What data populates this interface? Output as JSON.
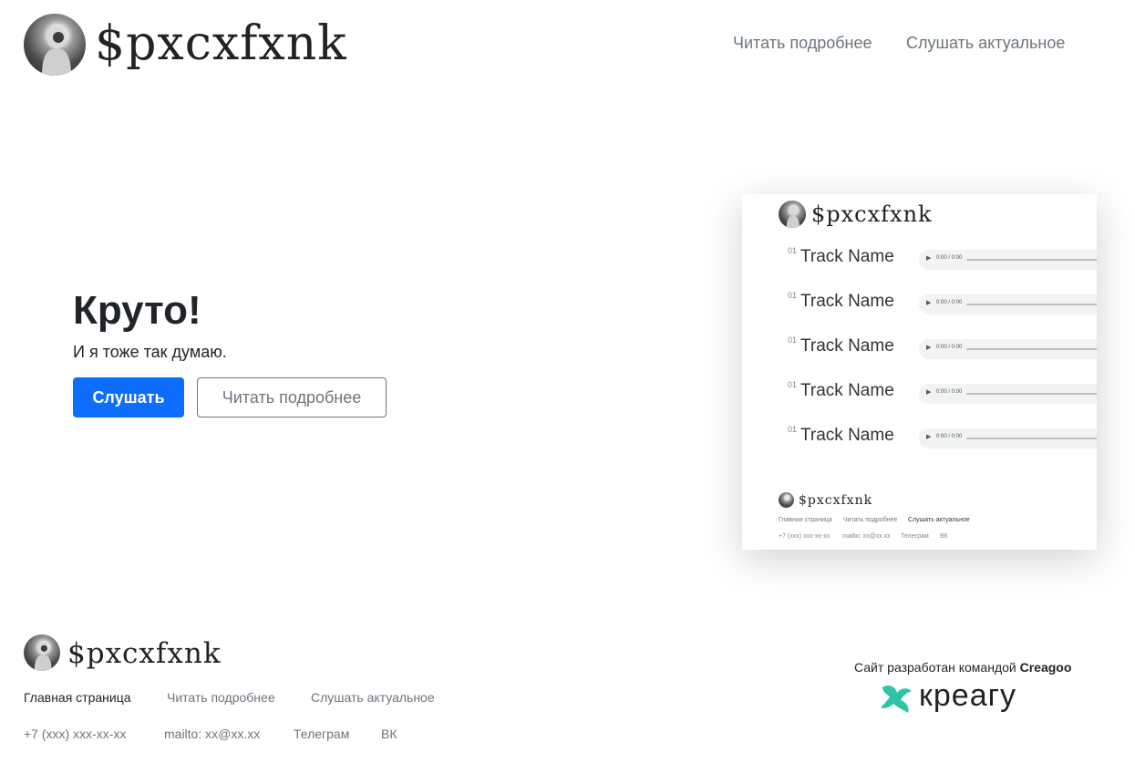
{
  "header": {
    "brand": "$pxcxfxnk",
    "nav": [
      "Читать подробнее",
      "Слушать актуальное"
    ]
  },
  "hero": {
    "title": "Круто!",
    "subtitle": "И я тоже так думаю.",
    "primary_button": "Слушать",
    "secondary_button": "Читать подробнее"
  },
  "preview": {
    "brand": "$pxcxfxnk",
    "tracks": [
      {
        "num": "01",
        "name": "Track Name",
        "time": "0:00 / 0:00"
      },
      {
        "num": "01",
        "name": "Track Name",
        "time": "0:00 / 0:00"
      },
      {
        "num": "01",
        "name": "Track Name",
        "time": "0:00 / 0:00"
      },
      {
        "num": "01",
        "name": "Track Name",
        "time": "0:00 / 0:00"
      },
      {
        "num": "01",
        "name": "Track Name",
        "time": "0:00 / 0:00"
      }
    ],
    "footer_brand": "$pxcxfxnk",
    "footer_links": [
      "Главная страница",
      "Читать подробнее",
      "Слушать актуальное"
    ],
    "footer_contacts": [
      "+7 (xxx) xxx-xx-xx",
      "mailto: xx@xx.xx",
      "Телеграм",
      "ВК"
    ]
  },
  "footer": {
    "brand": "$pxcxfxnk",
    "links": [
      "Главная страница",
      "Читать подробнее",
      "Слушать актуальное"
    ],
    "contacts": [
      "+7 (xxx) xxx-xx-xx",
      "mailto: xx@xx.xx",
      "Телеграм",
      "ВК"
    ],
    "credit_prefix": "Сайт разработан командой",
    "credit_team": "Creagoo",
    "credit_logo_text": "креагу"
  },
  "colors": {
    "primary": "#0d6efd",
    "muted": "#6c757d",
    "text": "#212529",
    "logo_teal": "#2ec4a6"
  }
}
